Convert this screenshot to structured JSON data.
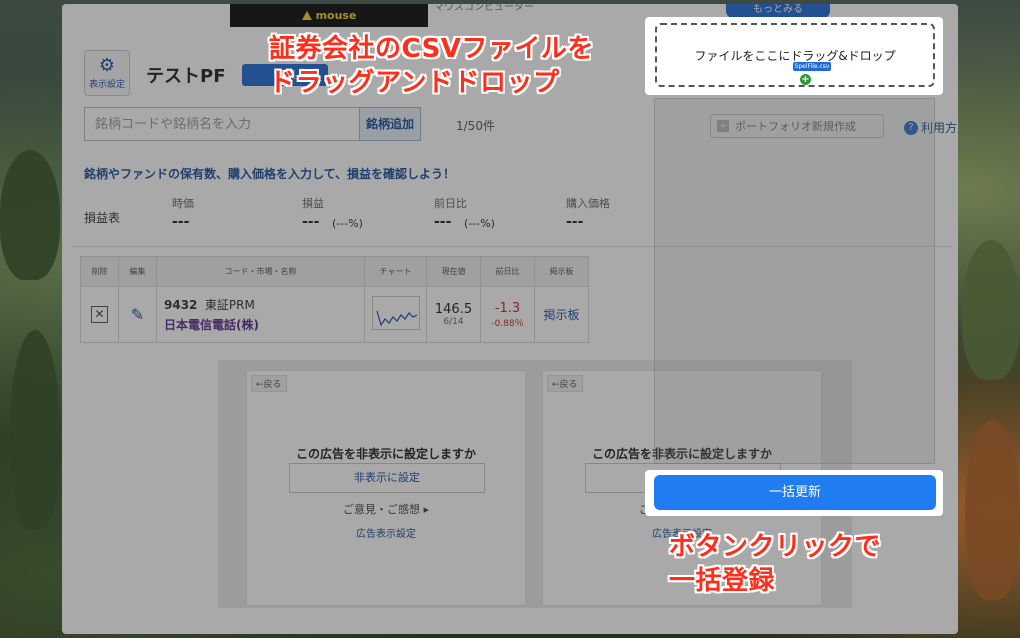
{
  "banner": {
    "brand": "mouse",
    "sub_text": "マウスコンピューター",
    "more_button": "もっとみる"
  },
  "header": {
    "settings_label": "表示設定",
    "portfolio_name": "テストPF",
    "edit_button": "編集"
  },
  "search": {
    "placeholder": "銘柄コードや銘柄名を入力",
    "add_button": "銘柄追加",
    "count": "1/50件"
  },
  "toolbar": {
    "new_portfolio": "ポートフォリオ新規作成",
    "usage": "利用方"
  },
  "pl": {
    "prompt": "銘柄やファンドの保有数、購入価格を入力して、損益を確認しよう！",
    "label": "損益表",
    "columns": [
      {
        "label": "時価",
        "value": "---",
        "pct": ""
      },
      {
        "label": "損益",
        "value": "---",
        "pct": "(---%)"
      },
      {
        "label": "前日比",
        "value": "---",
        "pct": "(---%)"
      },
      {
        "label": "購入価格",
        "value": "---",
        "pct": ""
      }
    ]
  },
  "table": {
    "headers": [
      "削除",
      "編集",
      "コード・市場・名称",
      "チャート",
      "現在値",
      "前日比",
      "掲示板"
    ],
    "row": {
      "delete_icon": "close-icon",
      "edit_icon": "pencil-icon",
      "code": "9432",
      "market": "東証PRM",
      "name": "日本電信電話(株)",
      "price": "146.5",
      "date": "6/14",
      "change": "-1.3",
      "change_pct": "-0.88％",
      "board": "掲示板"
    }
  },
  "ads": [
    {
      "back": "←戻る",
      "question": "この広告を非表示に設定しますか",
      "hide_button": "非表示に設定",
      "opinion": "ご意見・ご感想 ▸",
      "settings": "広告表示設定"
    },
    {
      "back": "←戻る",
      "question": "この広告を非表示に設定しますか",
      "hide_button": "非表示に設定",
      "opinion": "ご意見・ご感想 ▸",
      "settings": "広告表示設定"
    }
  ],
  "extension": {
    "dropzone_text": "ファイルをここにドラッグ&ドロップ",
    "dragged_file": "SpelFile.csv",
    "bulk_update_button": "一括更新"
  },
  "captions": {
    "top_line1": "証券会社のCSVファイルを",
    "top_line2": "ドラッグアンドドロップ",
    "bottom_line1": "ボタンクリックで",
    "bottom_line2": "一括登録"
  },
  "colors": {
    "accent": "#1f7cf2",
    "caption": "#ff2d1a",
    "negative": "#c62828"
  }
}
